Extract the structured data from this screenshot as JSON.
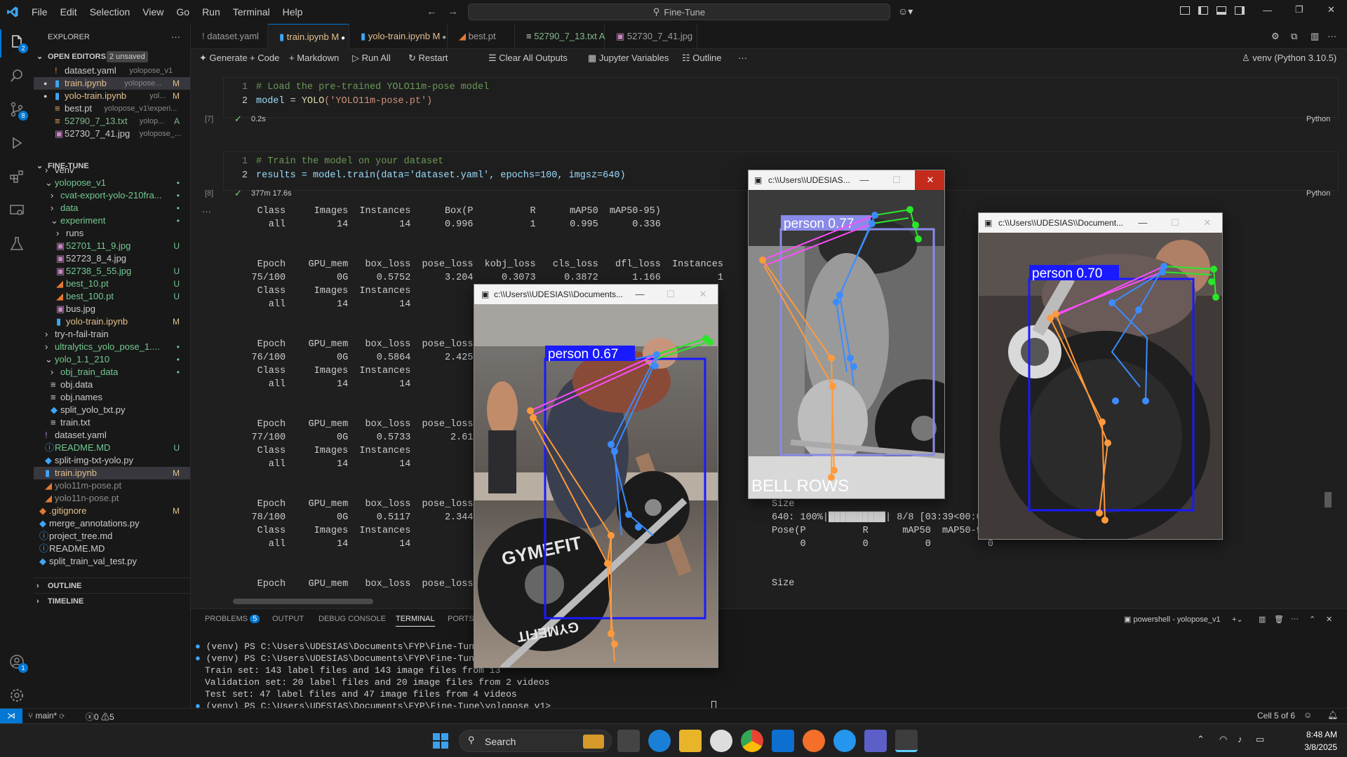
{
  "titlebar": {
    "menu": [
      "File",
      "Edit",
      "Selection",
      "View",
      "Go",
      "Run",
      "Terminal",
      "Help"
    ],
    "search_text": "Fine-Tune"
  },
  "activity": {
    "explorer_badge": "2",
    "scm_badge": "8",
    "account_badge": "1"
  },
  "explorer": {
    "title": "EXPLORER",
    "open_editors_label": "OPEN EDITORS",
    "unsaved_badge": "2 unsaved",
    "open_editors": [
      {
        "name": "dataset.yaml",
        "detail": "yolopose_v1",
        "status": ""
      },
      {
        "name": "train.ipynb",
        "detail": "yolopose...",
        "status": "M"
      },
      {
        "name": "yolo-train.ipynb",
        "detail": "yol...",
        "status": "M"
      },
      {
        "name": "best.pt",
        "detail": "yolopose_v1\\experi...",
        "status": ""
      },
      {
        "name": "52790_7_13.txt",
        "detail": "yolop...",
        "status": "A"
      },
      {
        "name": "52730_7_41.jpg",
        "detail": "yolopose_...",
        "status": ""
      }
    ],
    "workspace_label": "FINE-TUNE",
    "tree": [
      {
        "name": "venv",
        "status": ""
      },
      {
        "name": "yolopose_v1",
        "status": "•"
      },
      {
        "name": "cvat-export-yolo-210fra...",
        "status": "•"
      },
      {
        "name": "data",
        "status": "•"
      },
      {
        "name": "experiment",
        "status": "•"
      },
      {
        "name": "runs",
        "status": ""
      },
      {
        "name": "52701_11_9.jpg",
        "status": "U"
      },
      {
        "name": "52723_8_4.jpg",
        "status": ""
      },
      {
        "name": "52738_5_55.jpg",
        "status": "U"
      },
      {
        "name": "best_10.pt",
        "status": "U"
      },
      {
        "name": "best_100.pt",
        "status": "U"
      },
      {
        "name": "bus.jpg",
        "status": ""
      },
      {
        "name": "yolo-train.ipynb",
        "status": "M"
      },
      {
        "name": "try-n-fail-train",
        "status": ""
      },
      {
        "name": "ultralytics_yolo_pose_1....",
        "status": "•"
      },
      {
        "name": "yolo_1.1_210",
        "status": "•"
      },
      {
        "name": "obj_train_data",
        "status": "•"
      },
      {
        "name": "obj.data",
        "status": ""
      },
      {
        "name": "obj.names",
        "status": ""
      },
      {
        "name": "split_yolo_txt.py",
        "status": ""
      },
      {
        "name": "train.txt",
        "status": ""
      },
      {
        "name": "dataset.yaml",
        "status": ""
      },
      {
        "name": "README.MD",
        "status": "U"
      },
      {
        "name": "split-img-txt-yolo.py",
        "status": ""
      },
      {
        "name": "train.ipynb",
        "status": "M"
      },
      {
        "name": "yolo11m-pose.pt",
        "status": ""
      },
      {
        "name": "yolo11n-pose.pt",
        "status": ""
      },
      {
        "name": ".gitignore",
        "status": "M"
      },
      {
        "name": "merge_annotations.py",
        "status": ""
      },
      {
        "name": "project_tree.md",
        "status": ""
      },
      {
        "name": "README.MD",
        "status": ""
      },
      {
        "name": "split_train_val_test.py",
        "status": ""
      }
    ],
    "outline_label": "OUTLINE",
    "timeline_label": "TIMELINE"
  },
  "tabs": [
    {
      "name": "dataset.yaml",
      "mark": ""
    },
    {
      "name": "train.ipynb",
      "mark": "M"
    },
    {
      "name": "yolo-train.ipynb",
      "mark": "M"
    },
    {
      "name": "best.pt",
      "mark": ""
    },
    {
      "name": "52790_7_13.txt",
      "mark": "A"
    },
    {
      "name": "52730_7_41.jpg",
      "mark": ""
    }
  ],
  "toolbar": {
    "generate": "Generate",
    "code": "Code",
    "markdown": "Markdown",
    "run_all": "Run All",
    "restart": "Restart",
    "clear": "Clear All Outputs",
    "variables": "Jupyter Variables",
    "outline": "Outline",
    "kernel": "venv (Python 3.10.5)"
  },
  "cell7": {
    "exec": "[7]",
    "lang": "Python",
    "time": "0.2s",
    "line1": "# Load the pre-trained YOLO11m-pose model",
    "line2_a": "model",
    "line2_b": " = ",
    "line2_c": "YOLO",
    "line2_d": "('YOLO11m-pose.pt')"
  },
  "cell8": {
    "exec": "[8]",
    "lang": "Python",
    "time": "377m 17.6s",
    "line1": "# Train the model on your dataset",
    "line2": "results = model.train(data='dataset.yaml', epochs=100, imgsz=640)"
  },
  "output": {
    "left": [
      "      Class     Images  Instances      Box(P          R      mAP50  mAP50-95)",
      "        all         14         14      0.996          1      0.995      0.336",
      "",
      "",
      "      Epoch    GPU_mem   box_loss  pose_loss  kobj_loss   cls_loss   dfl_loss  Instances",
      "     75/100         0G     0.5752      3.204     0.3073     0.3872      1.166          1",
      "      Class     Images  Instances",
      "        all         14         14",
      "",
      "",
      "      Epoch    GPU_mem   box_loss  pose_loss",
      "     76/100         0G     0.5864      2.425",
      "      Class     Images  Instances",
      "        all         14         14",
      "",
      "",
      "      Epoch    GPU_mem   box_loss  pose_loss",
      "     77/100         0G     0.5733       2.61",
      "      Class     Images  Instances",
      "        all         14         14",
      "",
      "",
      "      Epoch    GPU_mem   box_loss  pose_loss",
      "     78/100         0G     0.5117      2.344",
      "      Class     Images  Instances",
      "        all         14         14",
      "",
      "",
      "      Epoch    GPU_mem   box_loss  pose_loss"
    ],
    "right_size": "Size",
    "right_progress": "640: 100%|██████████| 8/8 [03:39<00:00, 27.",
    "right_pose": "Pose(P          R      mAP50  mAP50-95): 100%|",
    "right_zeros": "     0          0          0          0"
  },
  "panel": {
    "tabs": [
      "PROBLEMS",
      "OUTPUT",
      "DEBUG CONSOLE",
      "TERMINAL",
      "PORTS"
    ],
    "problems_count": "5",
    "shell": "powershell - yolopose_v1",
    "lines": [
      "(venv) PS C:\\Users\\UDESIAS\\Documents\\FYP\\Fine-Tune> cd",
      "(venv) PS C:\\Users\\UDESIAS\\Documents\\FYP\\Fine-Tune\\yolo",
      "Train set: 143 label files and 143 image files from 13",
      "Validation set: 20 label files and 20 image files from 2 videos",
      "Test set: 47 label files and 47 image files from 4 videos",
      "(venv) PS C:\\Users\\UDESIAS\\Documents\\FYP\\Fine-Tune\\yolopose_v1> "
    ]
  },
  "windows": [
    {
      "title": "c:\\\\Users\\\\UDESIAS\\\\Documents...",
      "label": "person 0.67",
      "close_color": "#e81123"
    },
    {
      "title": "c:\\\\Users\\\\UDESIAS...",
      "label": "person 0.77",
      "close_color": "#c42b1c",
      "overlay": "BELL ROWS"
    },
    {
      "title": "c:\\\\Users\\\\UDESIAS\\\\Document...",
      "label": "person 0.70",
      "close_color": "#e81123"
    }
  ],
  "plate_text": {
    "top": "GYMEFIT",
    "bottom": "GYMEFIT"
  },
  "statusbar": {
    "branch": "main*",
    "errors": "0",
    "warnings": "5",
    "cell": "Cell 5 of 6"
  },
  "taskbar": {
    "search": "Search",
    "time": "8:48 AM",
    "date": "3/8/2025"
  },
  "colors": {
    "accent": "#0078d4",
    "box": "#1a1aff",
    "kp_orange": "#ff9a3c",
    "kp_blue": "#3c8cff",
    "kp_green": "#29e629",
    "kp_magenta": "#ff4dff"
  }
}
